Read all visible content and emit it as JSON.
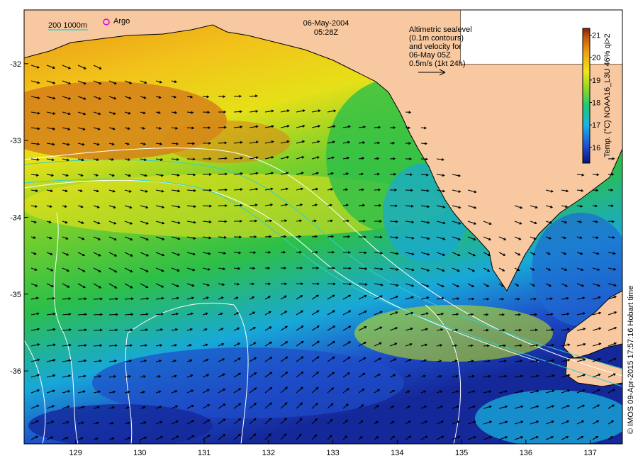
{
  "header": {
    "date": "06-May-2004",
    "time": "05:28Z"
  },
  "legend": {
    "isobaths": "200  1000m",
    "argo_label": "Argo"
  },
  "annotation": {
    "lines": [
      "Altimetric sealevel",
      "(0.1m contours)",
      "and velocity for",
      "06-May 05Z",
      "0.5m/s (1kt 24h)"
    ]
  },
  "colorbar": {
    "label": "Temp. (°C) NOAA16_L3U 46% qi>2",
    "ticks": [
      "16",
      "17",
      "18",
      "19",
      "20",
      "21"
    ],
    "range": [
      15.3,
      21.3
    ]
  },
  "credit": "© IMOS 09-Apr-2015 17:57:16 Hobart time",
  "axes": {
    "x_ticks": [
      "129",
      "130",
      "131",
      "132",
      "133",
      "134",
      "135",
      "136",
      "137"
    ],
    "y_ticks": [
      "-32",
      "-33",
      "-34",
      "-35",
      "-36"
    ],
    "lon_range": [
      128.2,
      137.5
    ],
    "lat_range": [
      -36.95,
      -31.3
    ]
  },
  "colors": {
    "land": "#f8c9a0",
    "warm": "#d97a12",
    "mid": "#7fd02a",
    "cool": "#14a0e0",
    "cold": "#1428a0",
    "isobath": "#30d0d0",
    "contour": "#ffffff"
  }
}
